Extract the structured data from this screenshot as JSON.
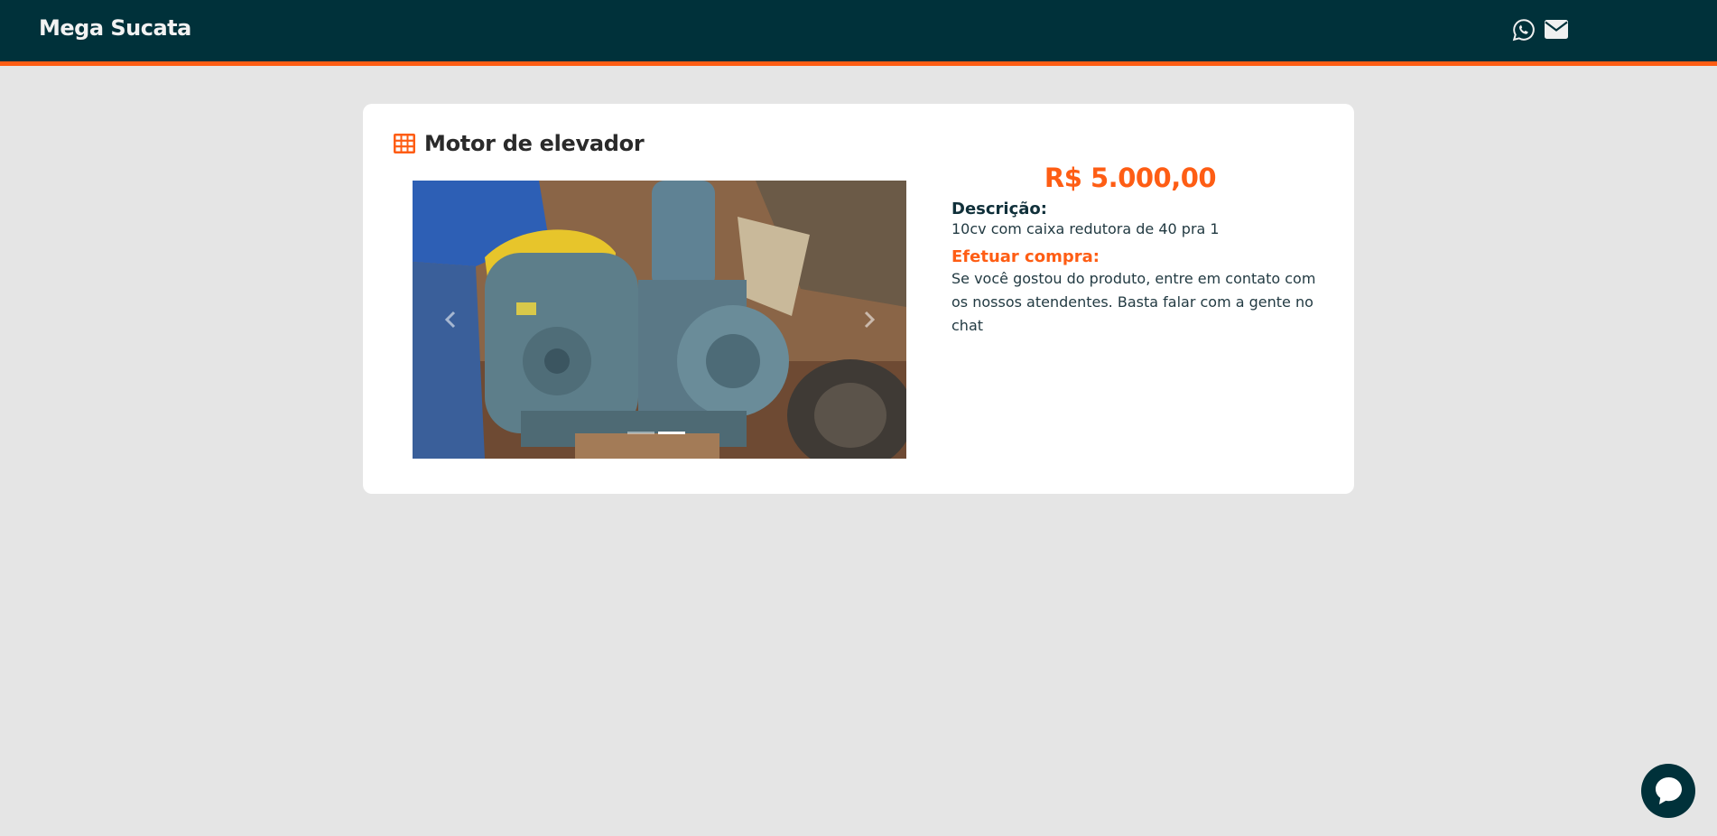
{
  "header": {
    "brand": "Mega Sucata",
    "icons": [
      "whatsapp-icon",
      "envelope-icon"
    ]
  },
  "product": {
    "icon": "table-grid-icon",
    "title": "Motor de elevador",
    "price": "R$ 5.000,00",
    "description_label": "Descrição:",
    "description": "10cv com caixa redutora de 40 pra 1",
    "purchase_label": "Efetuar compra:",
    "purchase_text": "Se você gostou do produto, entre em contato com os nossos atendentes. Basta falar com a gente no chat"
  },
  "carousel": {
    "slide_count": 3,
    "active_index": 2
  },
  "chat": {
    "icon": "chat-bubble-icon"
  },
  "colors": {
    "navbar": "#00313a",
    "accent": "#fe5d14",
    "background": "#e5e5e5"
  }
}
